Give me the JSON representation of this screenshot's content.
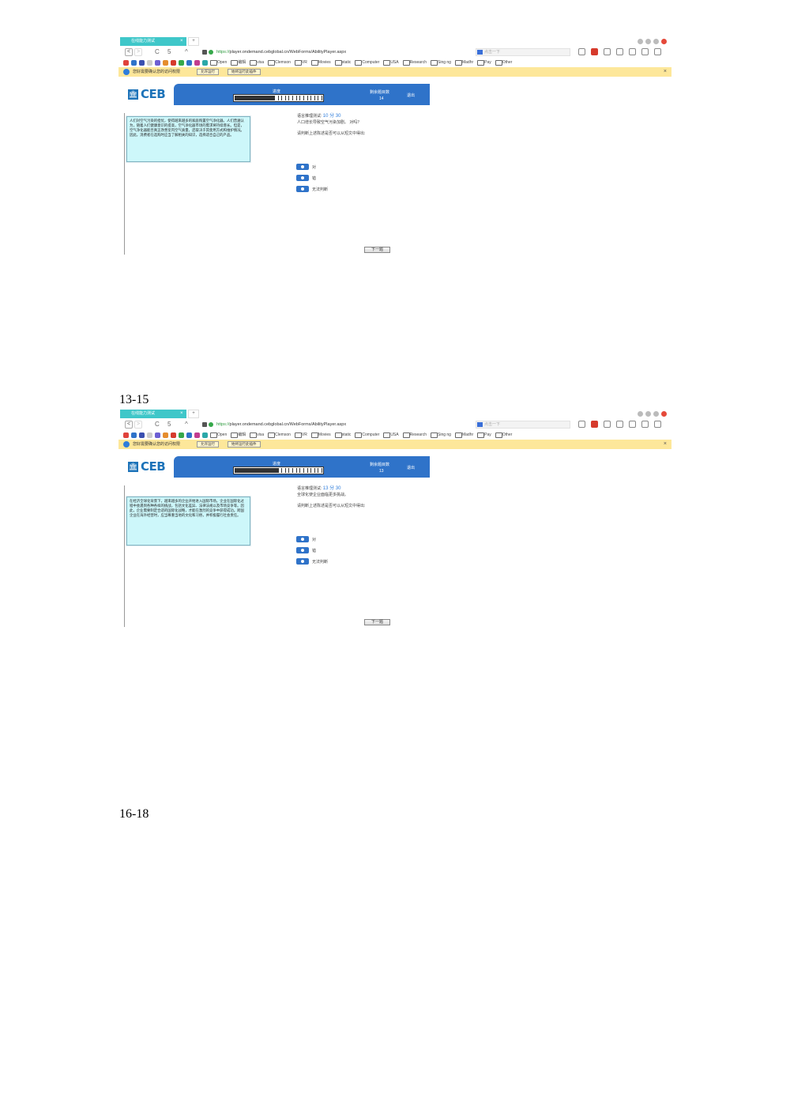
{
  "section_labels": [
    "13-15",
    "16-18"
  ],
  "browser": {
    "tab_title": "在线能力测试",
    "tab_close": "×",
    "new_tab": "+",
    "url_protocol": "https://",
    "url_rest": "player.ondemand.cebglobal.cn/WebForms/AbilityPlayer.aspx",
    "search_placeholder": "点击一下",
    "nav": {
      "back": "<",
      "forward": ">",
      "refresh": "C",
      "undo": "5",
      "home": "^"
    },
    "bookmarks": [
      "Open",
      "编辑",
      "visa",
      "Clemson",
      "VR",
      "Movies",
      "static",
      "Computer",
      "USA",
      "Research",
      "Sing ng",
      "Madhr",
      "Pay",
      "Other"
    ],
    "notification": {
      "text": "您好需要确认您的访问权限",
      "btn1": "允许运行",
      "btn2": "始终运行此插件",
      "close": "×"
    }
  },
  "screens": [
    {
      "logo_text": "CEB",
      "banner_progress_label": "进度",
      "banner_remaining_label": "剩余题目数",
      "banner_count": "14",
      "banner_time_label": "退出",
      "passage": "人们对空气污染的担忧，使得越来越多的家庭购置空气净化器。人们普遍认为，随着人们健康意识的提高，空气净化器市场的需求将持续增长。但是，空气净化器能否真正改善室内空气质量，还取决于其使用方式和维护情况。因此，消费者在选购时应当了解相关的知识，选择适合自己的产品。",
      "timer_label": "语言推理测试:",
      "timer_value": "10 分 30",
      "statement": "人口增长导致空气污染加剧。 对吗？",
      "prompt": "请判断上述陈述是否可以从短文中得出:",
      "options": [
        "对",
        "错",
        "无法判断"
      ],
      "next_label": "下一题"
    },
    {
      "logo_text": "CEB",
      "banner_progress_label": "进度",
      "banner_remaining_label": "剩余题目数",
      "banner_count": "13",
      "banner_time_label": "退出",
      "passage": "在经济全球化背景下，越来越多的企业开始进入国际市场。企业在国际化过程中会遇到各种各样的挑战，包括文化差异、法律法规以及市场竞争等。因此，企业需要制定合适的国际化战略，才能在激烈的竞争中获得成功。跨国企业在海外经营时，应当尊重当地的文化和习俗，并积极履行社会责任。",
      "timer_label": "语言推理测试:",
      "timer_value": "13 分 30",
      "statement": "全球化使企业面临更多挑战。",
      "prompt": "请判断上述陈述是否可以从短文中得出:",
      "options": [
        "对",
        "错",
        "无法判断"
      ],
      "next_label": "下一题"
    }
  ]
}
